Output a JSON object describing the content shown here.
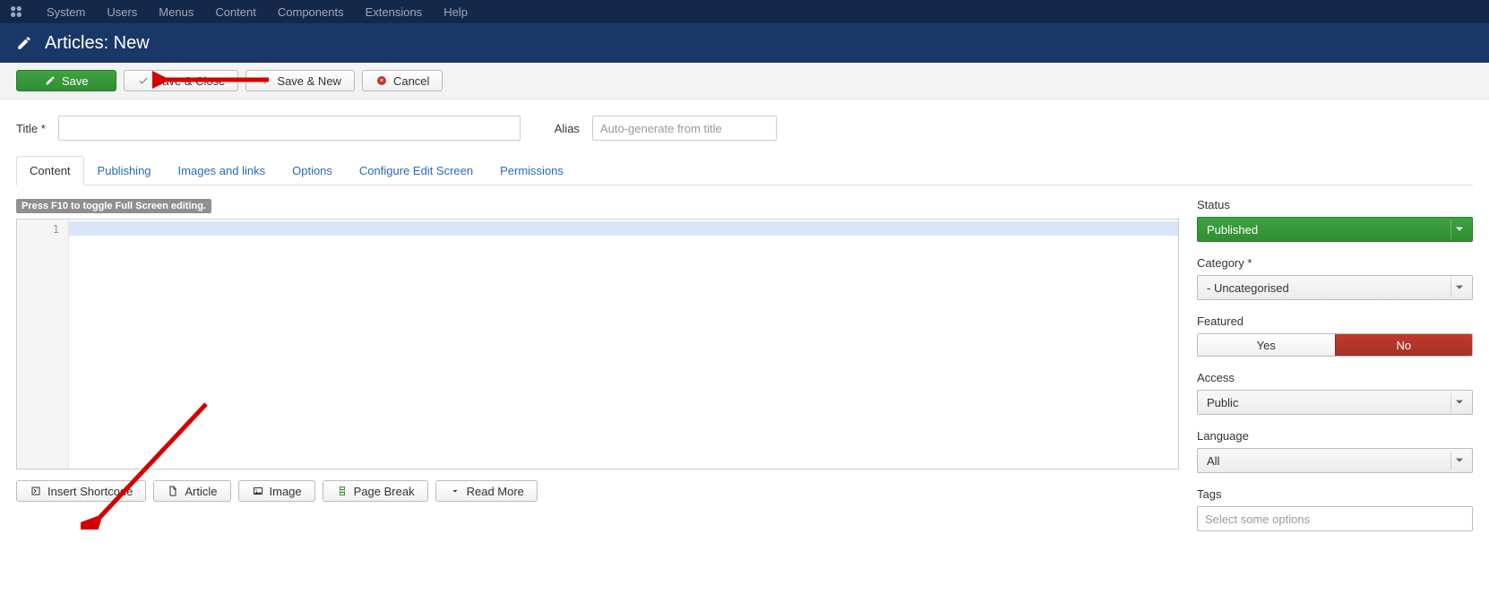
{
  "topnav": {
    "items": [
      "System",
      "Users",
      "Menus",
      "Content",
      "Components",
      "Extensions",
      "Help"
    ]
  },
  "header": {
    "title": "Articles: New"
  },
  "toolbar": {
    "save": "Save",
    "save_close": "Save & Close",
    "save_new": "Save & New",
    "cancel": "Cancel"
  },
  "fields": {
    "title_label": "Title *",
    "alias_label": "Alias",
    "alias_placeholder": "Auto-generate from title"
  },
  "tabs": {
    "items": [
      "Content",
      "Publishing",
      "Images and links",
      "Options",
      "Configure Edit Screen",
      "Permissions"
    ],
    "active": 0
  },
  "editor": {
    "hint": "Press F10 to toggle Full Screen editing.",
    "gutter_first": "1",
    "buttons": {
      "insert_shortcode": "Insert Shortcode",
      "article": "Article",
      "image": "Image",
      "page_break": "Page Break",
      "read_more": "Read More"
    }
  },
  "sidebar": {
    "status_label": "Status",
    "status_value": "Published",
    "category_label": "Category *",
    "category_value": "- Uncategorised",
    "featured_label": "Featured",
    "featured_yes": "Yes",
    "featured_no": "No",
    "access_label": "Access",
    "access_value": "Public",
    "language_label": "Language",
    "language_value": "All",
    "tags_label": "Tags",
    "tags_placeholder": "Select some options"
  }
}
